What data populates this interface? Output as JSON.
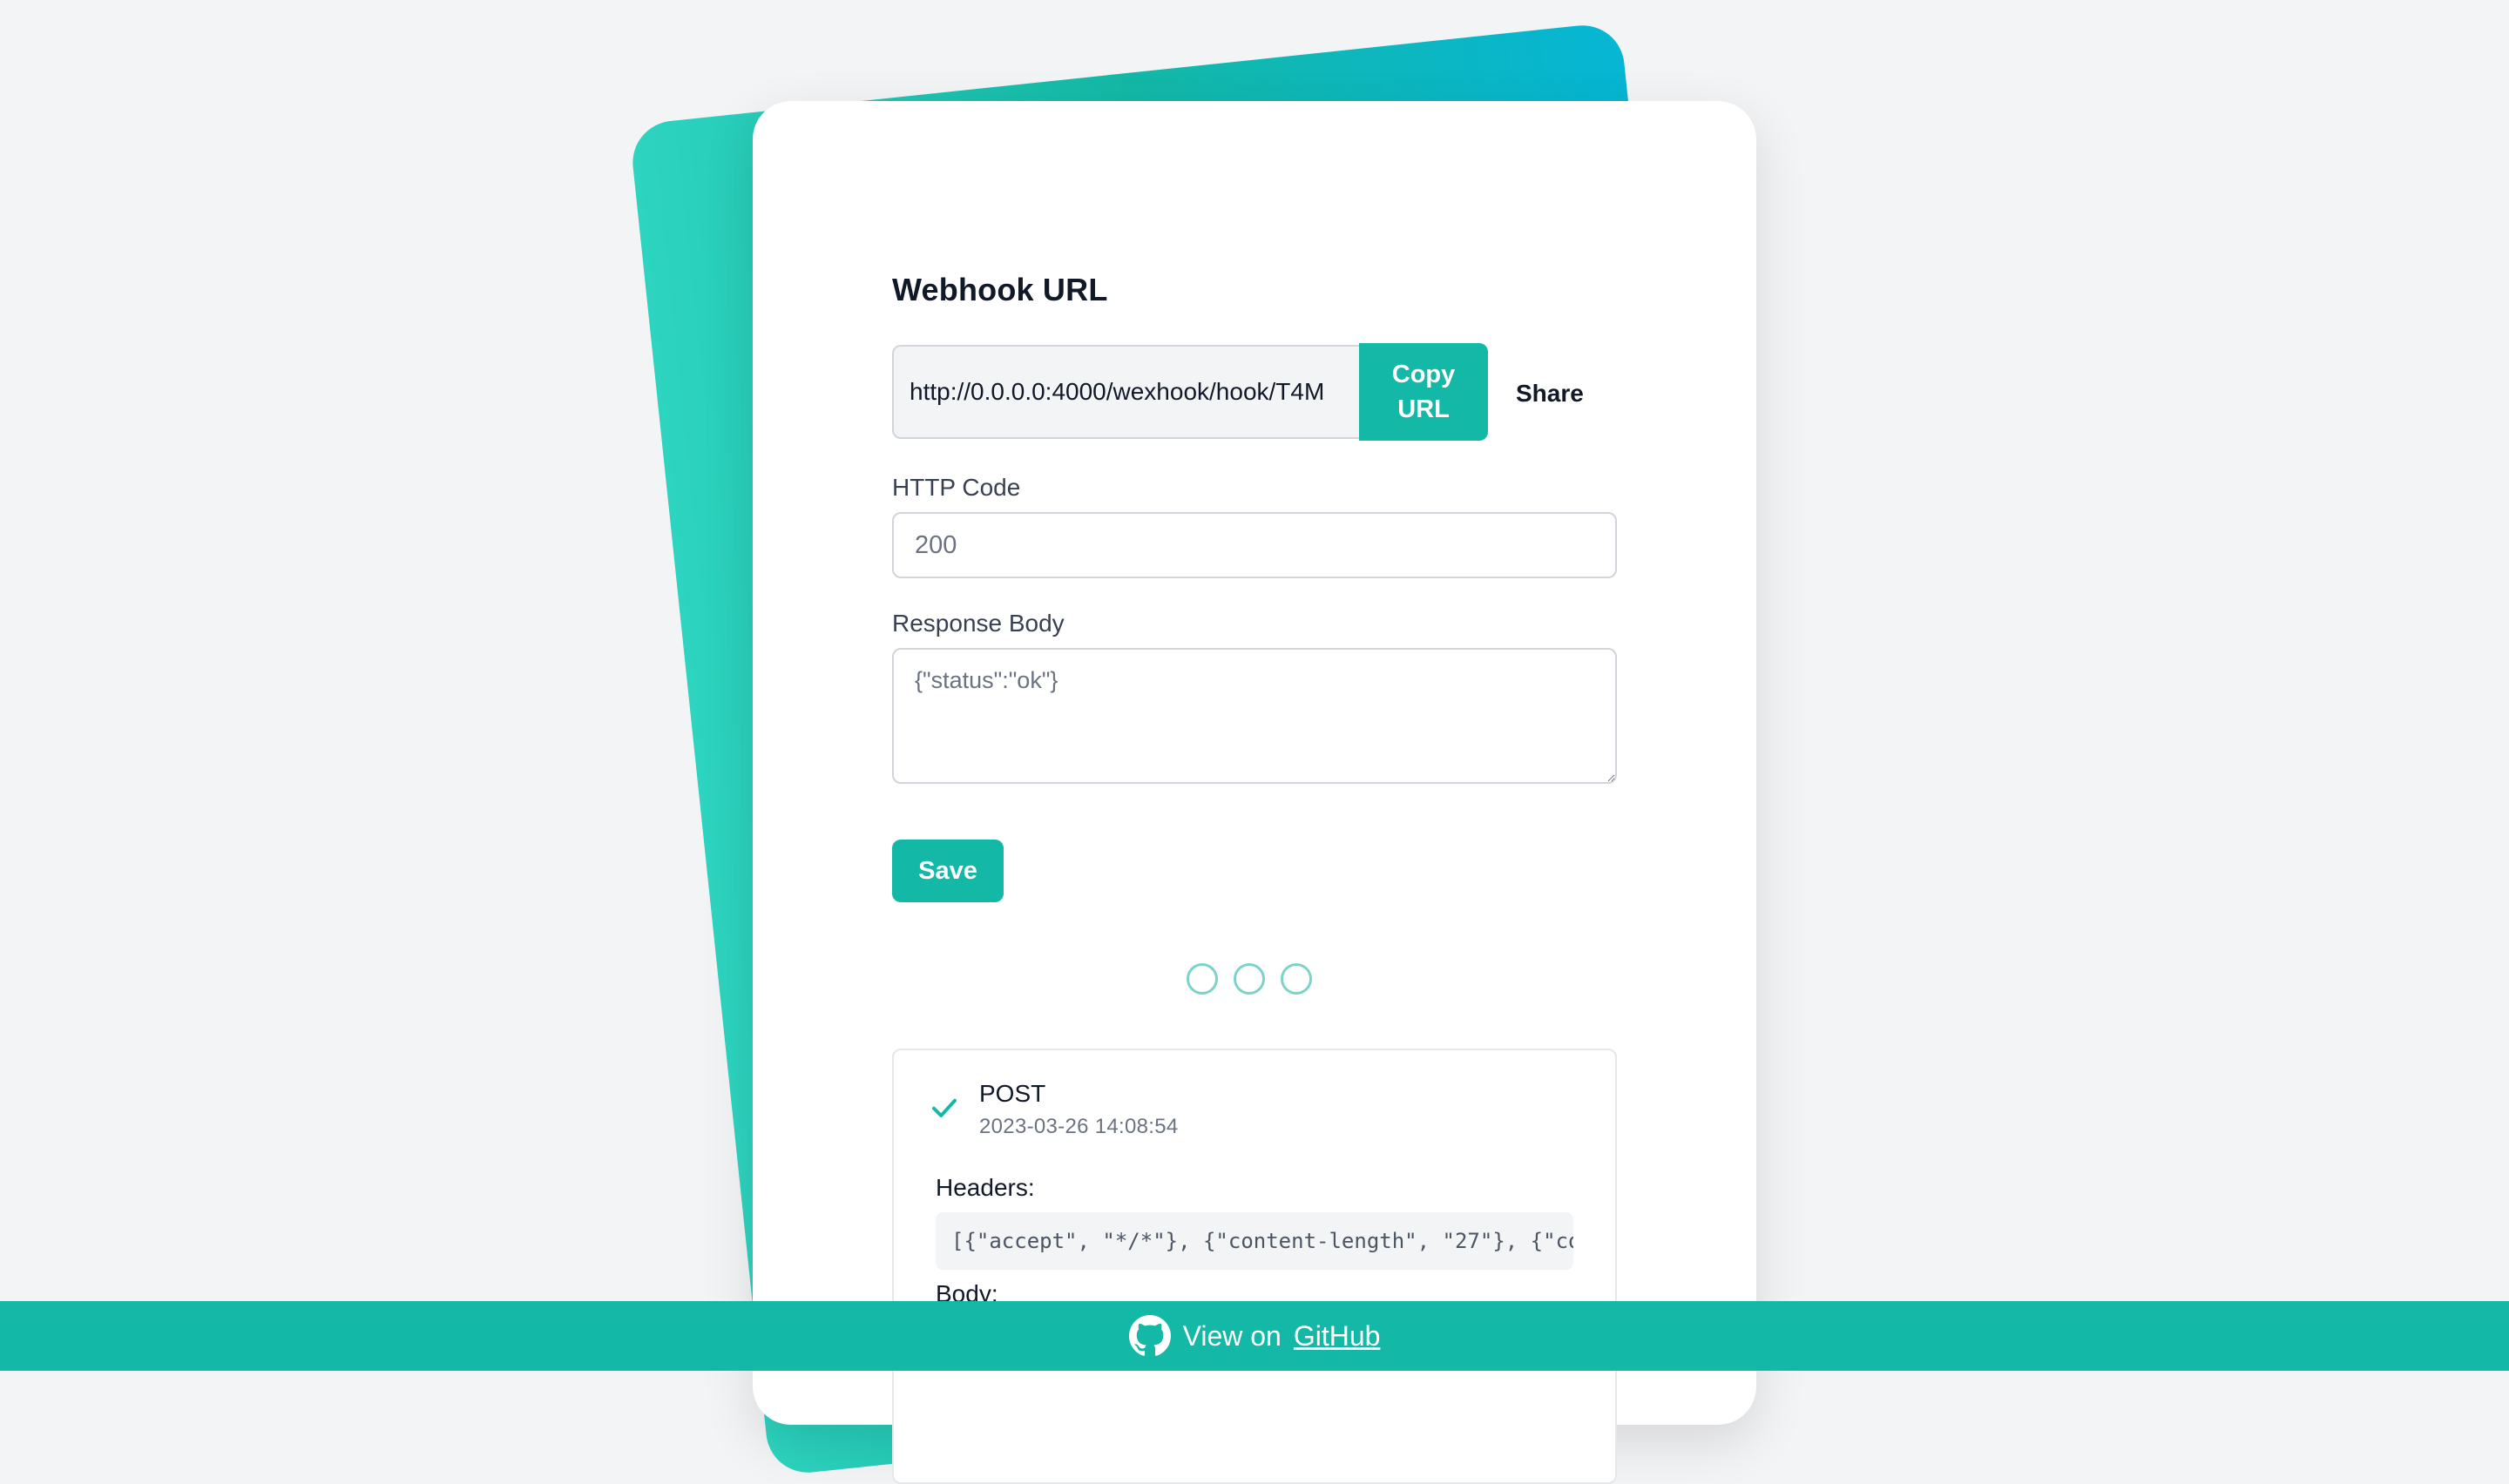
{
  "webhook": {
    "title": "Webhook URL",
    "url": "http://0.0.0.0:4000/wexhook/hook/T4M",
    "copy_label": "Copy URL",
    "share_label": "Share"
  },
  "form": {
    "http_code_label": "HTTP Code",
    "http_code_placeholder": "200",
    "response_body_label": "Response Body",
    "response_body_placeholder": "{\"status\":\"ok\"}",
    "save_label": "Save"
  },
  "request": {
    "method": "POST",
    "timestamp": "2023-03-26 14:08:54",
    "headers_label": "Headers:",
    "headers_value": "[{\"accept\", \"*/*\"}, {\"content-length\", \"27\"}, {\"co",
    "body_label": "Body:"
  },
  "footer": {
    "prefix": "View on",
    "link_text": "GitHub"
  },
  "colors": {
    "accent": "#14b8a6",
    "background": "#f3f4f6",
    "gradient_start": "#2dd4bf",
    "gradient_end": "#06b6d4"
  },
  "icons": {
    "status": "check-icon",
    "footer": "github-icon"
  }
}
